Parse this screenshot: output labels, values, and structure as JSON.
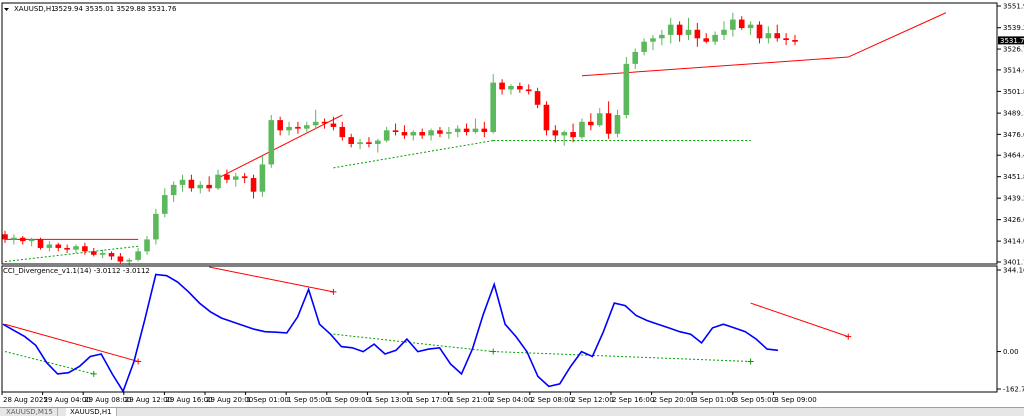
{
  "main_chart": {
    "symbol_label": "XAUUSD,H1",
    "ohlc_label": "3529.94 3535.01 3529.88 3531.76",
    "current_price_label": "3531.76",
    "price_ticks": [
      "3551.95",
      "3539.20",
      "3526.70",
      "3514.45",
      "3501.85",
      "3489.10",
      "3476.65",
      "3464.40",
      "3451.80",
      "3439.20",
      "3426.60",
      "3414.00",
      "3401.75"
    ]
  },
  "indicator": {
    "label": "CCI_Divergence_v1.1(14) -3.0112 -3.0112",
    "ticks": [
      "344.1692",
      "0.00",
      "-162.714"
    ]
  },
  "time_axis": [
    "28 Aug 2025",
    "29 Aug 04:00",
    "29 Aug 08:00",
    "29 Aug 12:00",
    "29 Aug 16:00",
    "29 Aug 20:00",
    "1 Sep 01:00",
    "1 Sep 05:00",
    "1 Sep 09:00",
    "1 Sep 13:00",
    "1 Sep 17:00",
    "1 Sep 21:00",
    "2 Sep 04:00",
    "2 Sep 08:00",
    "2 Sep 12:00",
    "2 Sep 16:00",
    "2 Sep 20:00",
    "3 Sep 01:00",
    "3 Sep 05:00",
    "3 Sep 09:00"
  ],
  "tabs": [
    {
      "label": "XAUUSD,M15",
      "active": false
    },
    {
      "label": "XAUUSD,H1",
      "active": true
    }
  ],
  "colors": {
    "bull": "#5cb85c",
    "bear": "#ff0000",
    "cci_line": "#0000ff",
    "bear_divergence": "#ff0000",
    "bull_divergence": "#00a000"
  },
  "chart_data": [
    {
      "type": "candlestick",
      "ylim": [
        3401.75,
        3551.95
      ],
      "candles": [
        [
          3418,
          3420,
          3413,
          3415
        ],
        [
          3415,
          3418,
          3412,
          3416
        ],
        [
          3416,
          3417,
          3412,
          3414
        ],
        [
          3414,
          3416,
          3411,
          3415
        ],
        [
          3415,
          3416,
          3409,
          3410
        ],
        [
          3410,
          3414,
          3408,
          3412
        ],
        [
          3412,
          3413,
          3408,
          3410
        ],
        [
          3410,
          3412,
          3407,
          3409
        ],
        [
          3409,
          3412,
          3407,
          3411
        ],
        [
          3411,
          3413,
          3406,
          3408
        ],
        [
          3408,
          3410,
          3405,
          3406
        ],
        [
          3406,
          3409,
          3404,
          3407
        ],
        [
          3407,
          3408,
          3403,
          3405
        ],
        [
          3405,
          3407,
          3401,
          3402
        ],
        [
          3402,
          3404,
          3400,
          3403
        ],
        [
          3403,
          3410,
          3402,
          3408
        ],
        [
          3408,
          3417,
          3406,
          3415
        ],
        [
          3415,
          3433,
          3412,
          3430
        ],
        [
          3430,
          3445,
          3428,
          3441
        ],
        [
          3441,
          3449,
          3437,
          3447
        ],
        [
          3447,
          3453,
          3443,
          3450
        ],
        [
          3450,
          3453,
          3443,
          3445
        ],
        [
          3445,
          3449,
          3442,
          3447
        ],
        [
          3447,
          3452,
          3443,
          3445
        ],
        [
          3445,
          3456,
          3444,
          3453
        ],
        [
          3453,
          3456,
          3448,
          3450
        ],
        [
          3450,
          3454,
          3446,
          3452
        ],
        [
          3452,
          3454,
          3448,
          3451
        ],
        [
          3451,
          3453,
          3439,
          3443
        ],
        [
          3443,
          3464,
          3440,
          3459
        ],
        [
          3459,
          3488,
          3457,
          3485
        ],
        [
          3485,
          3487,
          3476,
          3479
        ],
        [
          3479,
          3484,
          3476,
          3481
        ],
        [
          3481,
          3484,
          3477,
          3480
        ],
        [
          3480,
          3484,
          3478,
          3482
        ],
        [
          3482,
          3491,
          3480,
          3484
        ],
        [
          3484,
          3486,
          3480,
          3483
        ],
        [
          3483,
          3487,
          3479,
          3481
        ],
        [
          3481,
          3484,
          3473,
          3475
        ],
        [
          3475,
          3477,
          3469,
          3471
        ],
        [
          3471,
          3474,
          3468,
          3472
        ],
        [
          3472,
          3475,
          3469,
          3471
        ],
        [
          3471,
          3474,
          3466,
          3473
        ],
        [
          3473,
          3481,
          3472,
          3479
        ],
        [
          3479,
          3483,
          3476,
          3478
        ],
        [
          3478,
          3482,
          3474,
          3476
        ],
        [
          3476,
          3479,
          3473,
          3478
        ],
        [
          3478,
          3480,
          3474,
          3476
        ],
        [
          3476,
          3480,
          3473,
          3479
        ],
        [
          3479,
          3481,
          3475,
          3477
        ],
        [
          3477,
          3481,
          3474,
          3478
        ],
        [
          3478,
          3482,
          3475,
          3480
        ],
        [
          3480,
          3483,
          3476,
          3478
        ],
        [
          3478,
          3486,
          3477,
          3480
        ],
        [
          3480,
          3484,
          3475,
          3478
        ],
        [
          3478,
          3512,
          3477,
          3507
        ],
        [
          3507,
          3509,
          3500,
          3503
        ],
        [
          3503,
          3506,
          3500,
          3505
        ],
        [
          3505,
          3507,
          3501,
          3503
        ],
        [
          3503,
          3506,
          3500,
          3502
        ],
        [
          3502,
          3504,
          3492,
          3494
        ],
        [
          3494,
          3496,
          3476,
          3479
        ],
        [
          3479,
          3482,
          3472,
          3476
        ],
        [
          3476,
          3479,
          3470,
          3478
        ],
        [
          3478,
          3483,
          3472,
          3475
        ],
        [
          3475,
          3486,
          3474,
          3484
        ],
        [
          3484,
          3489,
          3479,
          3482
        ],
        [
          3482,
          3492,
          3481,
          3489
        ],
        [
          3489,
          3496,
          3474,
          3477
        ],
        [
          3477,
          3491,
          3475,
          3488
        ],
        [
          3488,
          3522,
          3486,
          3518
        ],
        [
          3518,
          3527,
          3515,
          3525
        ],
        [
          3525,
          3533,
          3523,
          3531
        ],
        [
          3531,
          3535,
          3526,
          3533
        ],
        [
          3533,
          3538,
          3529,
          3535
        ],
        [
          3535,
          3545,
          3530,
          3541
        ],
        [
          3541,
          3543,
          3531,
          3535
        ],
        [
          3535,
          3545,
          3532,
          3538
        ],
        [
          3538,
          3542,
          3528,
          3533
        ],
        [
          3533,
          3536,
          3530,
          3531
        ],
        [
          3531,
          3537,
          3529,
          3535
        ],
        [
          3535,
          3543,
          3532,
          3538
        ],
        [
          3538,
          3548,
          3534,
          3544
        ],
        [
          3544,
          3546,
          3538,
          3539
        ],
        [
          3539,
          3543,
          3535,
          3541
        ],
        [
          3541,
          3543,
          3530,
          3533
        ],
        [
          3533,
          3540,
          3530,
          3536
        ],
        [
          3536,
          3541,
          3531,
          3533
        ],
        [
          3533,
          3536,
          3529,
          3532
        ],
        [
          3532,
          3535,
          3529,
          3531
        ]
      ],
      "trendlines": [
        {
          "kind": "bear",
          "from": [
            0,
            3415
          ],
          "to": [
            15,
            3415
          ]
        },
        {
          "kind": "bear",
          "from": [
            24,
            3451
          ],
          "to": [
            38,
            3488
          ]
        },
        {
          "kind": "bear",
          "from": [
            65,
            3511
          ],
          "to": [
            95,
            3522
          ]
        },
        {
          "kind": "bear",
          "from": [
            95,
            3522
          ],
          "to": [
            106,
            3548
          ]
        },
        {
          "kind": "bull",
          "from": [
            0,
            3402
          ],
          "to": [
            15,
            3411
          ]
        },
        {
          "kind": "bull",
          "from": [
            37,
            3457
          ],
          "to": [
            55,
            3473
          ]
        },
        {
          "kind": "bull",
          "from": [
            55,
            3473
          ],
          "to": [
            84,
            3473
          ]
        }
      ]
    },
    {
      "type": "line",
      "ylim": [
        -162.714,
        344.1692
      ],
      "values": [
        110,
        85,
        60,
        25,
        -45,
        -90,
        -85,
        -60,
        -20,
        -10,
        -90,
        -160,
        -40,
        130,
        310,
        305,
        280,
        240,
        195,
        160,
        135,
        120,
        105,
        90,
        80,
        78,
        75,
        140,
        250,
        110,
        70,
        20,
        15,
        0,
        30,
        -10,
        5,
        50,
        0,
        10,
        15,
        -50,
        -90,
        10,
        150,
        270,
        110,
        60,
        0,
        -100,
        -140,
        -130,
        -60,
        0,
        -20,
        80,
        195,
        185,
        145,
        125,
        110,
        95,
        80,
        70,
        35,
        95,
        110,
        95,
        80,
        50,
        10,
        5
      ],
      "divergences": [
        {
          "kind": "bear",
          "from": [
            0,
            110
          ],
          "to": [
            15,
            -40
          ]
        },
        {
          "kind": "bear",
          "from": [
            23,
            340
          ],
          "to": [
            37,
            240
          ]
        },
        {
          "kind": "bear",
          "from": [
            84,
            195
          ],
          "to": [
            95,
            60
          ]
        },
        {
          "kind": "bull",
          "from": [
            0,
            0
          ],
          "to": [
            10,
            -90
          ]
        },
        {
          "kind": "bull",
          "from": [
            37,
            70
          ],
          "to": [
            55,
            0
          ]
        },
        {
          "kind": "bull",
          "from": [
            55,
            0
          ],
          "to": [
            84,
            -40
          ]
        }
      ]
    }
  ]
}
